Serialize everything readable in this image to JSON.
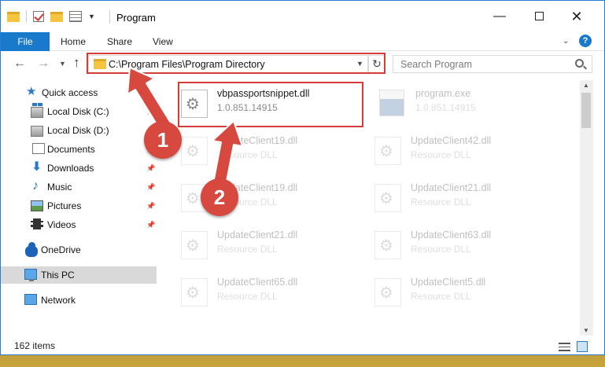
{
  "window": {
    "title": "Program",
    "min_glyph": "—",
    "close_glyph": "✕"
  },
  "ribbon": {
    "file": "File",
    "home": "Home",
    "share": "Share",
    "view": "View",
    "help": "?"
  },
  "nav": {
    "back": "←",
    "forward": "→",
    "up": "↑",
    "address": "C:\\Program Files\\Program Directory",
    "refresh": "↻",
    "search_placeholder": "Search Program"
  },
  "sidebar": {
    "items": [
      {
        "label": "Quick access",
        "icon": "star-icon",
        "pinned": false
      },
      {
        "label": "Local Disk (C:)",
        "icon": "disk-icon",
        "pinned": true
      },
      {
        "label": "Local Disk (D:)",
        "icon": "disk-icon",
        "pinned": true
      },
      {
        "label": "Documents",
        "icon": "documents-icon",
        "pinned": true
      },
      {
        "label": "Downloads",
        "icon": "download-icon",
        "pinned": true
      },
      {
        "label": "Music",
        "icon": "music-icon",
        "pinned": true
      },
      {
        "label": "Pictures",
        "icon": "pictures-icon",
        "pinned": true
      },
      {
        "label": "Videos",
        "icon": "videos-icon",
        "pinned": true
      },
      {
        "label": "OneDrive",
        "icon": "cloud-icon",
        "pinned": false
      },
      {
        "label": "This PC",
        "icon": "computer-icon",
        "pinned": false,
        "selected": true
      },
      {
        "label": "Network",
        "icon": "network-icon",
        "pinned": false
      }
    ]
  },
  "files": [
    {
      "name": "vbpassportsnippet.dll",
      "sub": "1.0.851.14915",
      "highlighted": true
    },
    {
      "name": "program.exe",
      "sub": "1.0.851.14915"
    },
    {
      "name": "UpdateClient19.dll",
      "sub": "Resource DLL"
    },
    {
      "name": "UpdateClient42.dll",
      "sub": "Resource DLL"
    },
    {
      "name": "UpdateClient19.dll",
      "sub": "Resource DLL"
    },
    {
      "name": "UpdateClient21.dll",
      "sub": "Resource DLL"
    },
    {
      "name": "UpdateClient21.dll",
      "sub": "Resource DLL"
    },
    {
      "name": "UpdateClient63.dll",
      "sub": "Resource DLL"
    },
    {
      "name": "UpdateClient65.dll",
      "sub": "Resource DLL"
    },
    {
      "name": "UpdateClient5.dll",
      "sub": "Resource DLL"
    }
  ],
  "status": {
    "item_count": "162 items"
  },
  "callouts": {
    "one": "1",
    "two": "2"
  },
  "colors": {
    "accent": "#1979ca",
    "highlight": "#d43b3b",
    "badge": "#d7483f"
  }
}
